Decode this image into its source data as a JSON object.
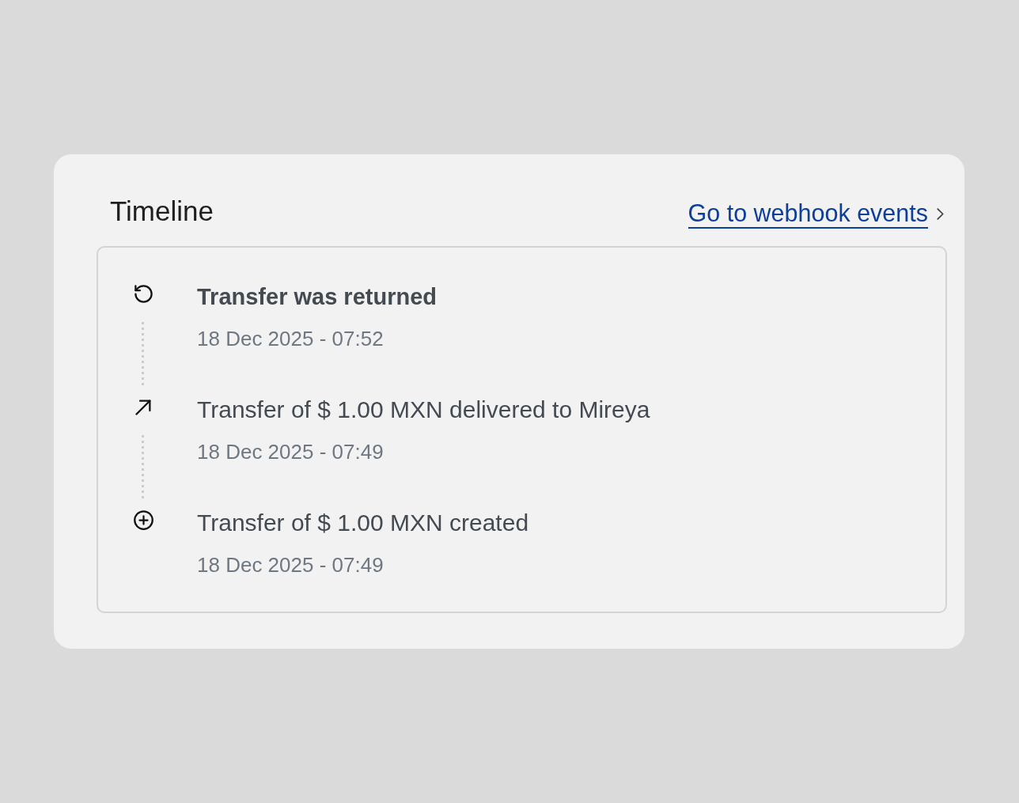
{
  "card": {
    "title": "Timeline",
    "link": {
      "label": "Go to webhook events"
    }
  },
  "events": [
    {
      "kind": "returned",
      "title": "Transfer was returned",
      "highlighted": true,
      "date": "18 Dec 2025 - 07:52"
    },
    {
      "kind": "delivered",
      "title": "Transfer of $ 1.00 MXN delivered to Mireya",
      "highlighted": false,
      "date": "18 Dec 2025 - 07:49"
    },
    {
      "kind": "created",
      "title": "Transfer of $ 1.00 MXN created",
      "highlighted": false,
      "date": "18 Dec 2025 - 07:49"
    }
  ]
}
